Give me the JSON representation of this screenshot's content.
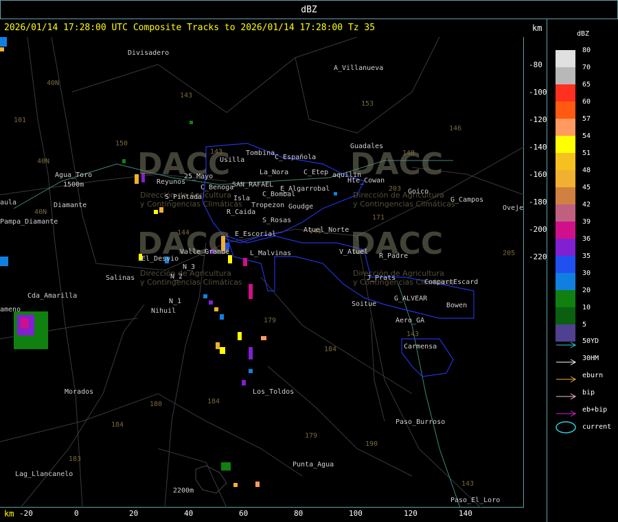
{
  "header": {
    "title": "dBZ"
  },
  "map": {
    "subtitle": "2026/01/14 17:28:00 UTC Composite Tracks to 2026/01/14 17:28:00 Tz 35",
    "unit_top": "km",
    "unit_bottom": "km",
    "y_ticks": [
      "-80",
      "-100",
      "-120",
      "-140",
      "-160",
      "-180",
      "-200",
      "-220"
    ],
    "x_ticks": [
      "-20",
      "0",
      "20",
      "40",
      "60",
      "80",
      "100",
      "120",
      "140"
    ],
    "places": [
      {
        "name": "Divisadero",
        "color": "#d0d0d0"
      },
      {
        "name": "A_Villanueva",
        "color": "#d0d0d0"
      },
      {
        "name": "Guadales",
        "color": "#d0d0d0"
      },
      {
        "name": "Tombina",
        "color": "#d0d0d0"
      },
      {
        "name": "Usilla",
        "color": "#d0d0d0"
      },
      {
        "name": "C_Española",
        "color": "#d0d0d0"
      },
      {
        "name": "La_Nora",
        "color": "#d0d0d0"
      },
      {
        "name": "C_Etep",
        "color": "#d0d0d0"
      },
      {
        "name": "aquilin",
        "color": "#d0d0d0"
      },
      {
        "name": "Hte_Cowan",
        "color": "#d0d0d0"
      },
      {
        "name": "Agua_Toro",
        "color": "#d0d0d0"
      },
      {
        "name": "Reyunos",
        "color": "#d0d0d0"
      },
      {
        "name": "25_Mayo",
        "color": "#d0d0d0"
      },
      {
        "name": "C_Benoga",
        "color": "#d0d0d0"
      },
      {
        "name": "SAN_RAFAEL",
        "color": "#d0d0d0"
      },
      {
        "name": "E_Algarrobal",
        "color": "#d0d0d0"
      },
      {
        "name": "C_Bombal",
        "color": "#d0d0d0"
      },
      {
        "name": "Goico",
        "color": "#d0d0d0"
      },
      {
        "name": "G_Campos",
        "color": "#d0d0d0"
      },
      {
        "name": "Oveje",
        "color": "#d0d0d0"
      },
      {
        "name": "aula",
        "color": "#d0d0d0"
      },
      {
        "name": "S_Pintada",
        "color": "#d0d0d0"
      },
      {
        "name": "Isla",
        "color": "#d0d0d0"
      },
      {
        "name": "Tropezon",
        "color": "#d0d0d0"
      },
      {
        "name": "Goudge",
        "color": "#d0d0d0"
      },
      {
        "name": "Pampa_Diamante",
        "color": "#d0d0d0"
      },
      {
        "name": "R_Caida",
        "color": "#d0d0d0"
      },
      {
        "name": "S_Rosas",
        "color": "#d0d0d0"
      },
      {
        "name": "Atuel_Norte",
        "color": "#d0d0d0"
      },
      {
        "name": "E_Escorial",
        "color": "#d0d0d0"
      },
      {
        "name": "Valle_Grande",
        "color": "#d0d0d0"
      },
      {
        "name": "L_Malvinas",
        "color": "#d0d0d0"
      },
      {
        "name": "V_Atuel",
        "color": "#d0d0d0"
      },
      {
        "name": "R_Padre",
        "color": "#d0d0d0"
      },
      {
        "name": "El_Desvio",
        "color": "#d0d0d0"
      },
      {
        "name": "N_2",
        "color": "#d0d0d0"
      },
      {
        "name": "N_3",
        "color": "#d0d0d0"
      },
      {
        "name": "Salinas",
        "color": "#d0d0d0"
      },
      {
        "name": "J_Prats",
        "color": "#d0d0d0"
      },
      {
        "name": "CompartEscard",
        "color": "#d0d0d0"
      },
      {
        "name": "Cda_Amarilla",
        "color": "#d0d0d0"
      },
      {
        "name": "N_1",
        "color": "#d0d0d0"
      },
      {
        "name": "Nihuil",
        "color": "#d0d0d0"
      },
      {
        "name": "Soitue",
        "color": "#d0d0d0"
      },
      {
        "name": "G_ALVEAR",
        "color": "#d0d0d0"
      },
      {
        "name": "Bowen",
        "color": "#d0d0d0"
      },
      {
        "name": "Aero_GA",
        "color": "#d0d0d0"
      },
      {
        "name": "Carmensa",
        "color": "#d0d0d0"
      },
      {
        "name": "Morados",
        "color": "#d0d0d0"
      },
      {
        "name": "Los_Toldos",
        "color": "#d0d0d0"
      },
      {
        "name": "Paso_Burroso",
        "color": "#d0d0d0"
      },
      {
        "name": "Punta_Agua",
        "color": "#d0d0d0"
      },
      {
        "name": "Lag_Llancanelo",
        "color": "#d0d0d0"
      },
      {
        "name": "Paso_El_Loro",
        "color": "#d0d0d0"
      },
      {
        "name": "Diamante",
        "color": "#d0d0d0"
      },
      {
        "name": "1500m",
        "color": "#d0d0d0"
      },
      {
        "name": "2200m",
        "color": "#d0d0d0"
      },
      {
        "name": "ameno",
        "color": "#d0d0d0"
      }
    ],
    "routes": [
      "40N",
      "101",
      "40N",
      "40N",
      "143",
      "153",
      "146",
      "150",
      "143",
      "148",
      "203",
      "171",
      "144",
      "143",
      "179",
      "184",
      "180",
      "184",
      "184",
      "183",
      "179",
      "190",
      "143",
      "143",
      "205"
    ],
    "watermarks": [
      {
        "logo": "DACC",
        "line1": "Dirección de Agricultura",
        "line2": "y Contingencias Climáticas"
      },
      {
        "logo": "DACC",
        "line1": "Dirección de Agricultura",
        "line2": "y Contingencias Climáticas"
      },
      {
        "logo": "DACC",
        "line1": "Dirección de Agricultura",
        "line2": "y Contingencias Climáticas"
      },
      {
        "logo": "DACC",
        "line1": "Dirección de Agricultura",
        "line2": "y Contingencias Climáticas"
      }
    ]
  },
  "legend": {
    "title": "dBZ",
    "scale": [
      {
        "label": "80",
        "color": "#e0e0e0"
      },
      {
        "label": "70",
        "color": "#b8b8b8"
      },
      {
        "label": "65",
        "color": "#ff3020"
      },
      {
        "label": "60",
        "color": "#ff5a10"
      },
      {
        "label": "57",
        "color": "#ff9a60"
      },
      {
        "label": "54",
        "color": "#ffff00"
      },
      {
        "label": "51",
        "color": "#f5c020"
      },
      {
        "label": "48",
        "color": "#f0b030"
      },
      {
        "label": "45",
        "color": "#d08040"
      },
      {
        "label": "42",
        "color": "#c06080"
      },
      {
        "label": "39",
        "color": "#d0108a"
      },
      {
        "label": "36",
        "color": "#8020d0"
      },
      {
        "label": "35",
        "color": "#2050f0"
      },
      {
        "label": "30",
        "color": "#1080e0"
      },
      {
        "label": "20",
        "color": "#108010"
      },
      {
        "label": "10",
        "color": "#0a6010"
      },
      {
        "label": "5",
        "color": "#504090"
      }
    ],
    "tracks": [
      {
        "label": "50YD",
        "color": "#30d0e0"
      },
      {
        "label": "30HM",
        "color": "#ffffff"
      },
      {
        "label": "eburn",
        "color": "#ffb040"
      },
      {
        "label": "bip",
        "color": "#ffc0d0"
      },
      {
        "label": "eb+bip",
        "color": "#e020e0"
      },
      {
        "label": "current",
        "color": "#30d0e0"
      }
    ]
  }
}
